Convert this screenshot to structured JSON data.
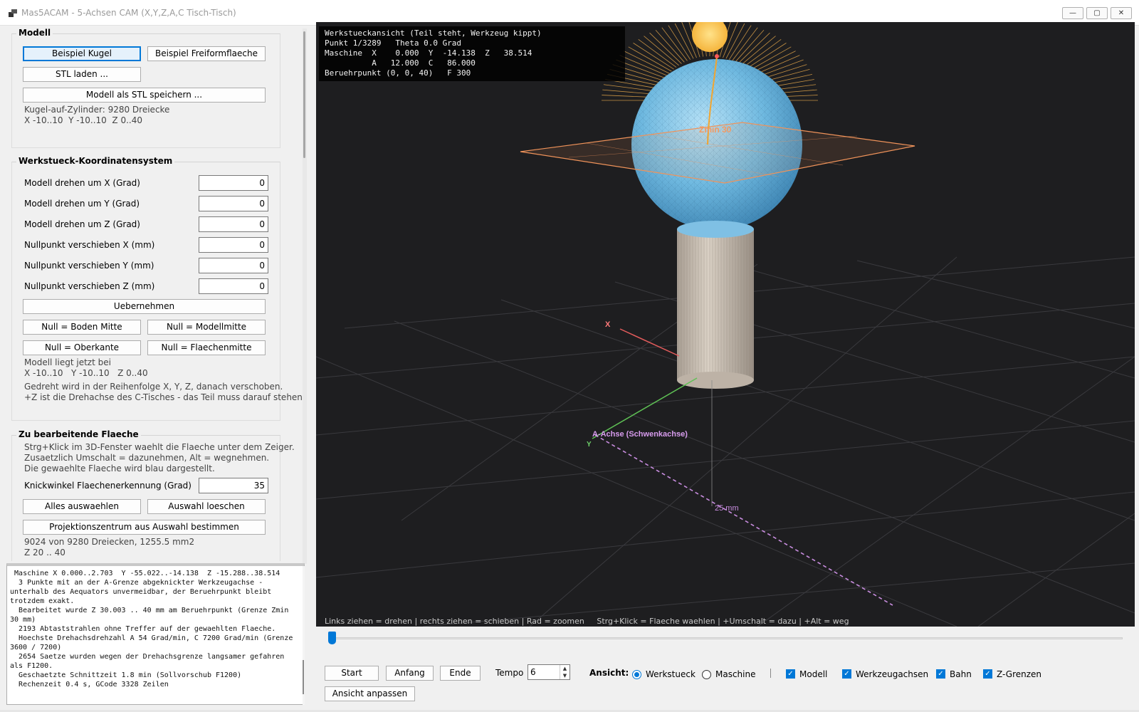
{
  "window": {
    "title": "Mas5ACAM - 5-Achsen CAM (X,Y,Z,A,C Tisch-Tisch)",
    "minimize": "—",
    "maximize": "▢",
    "close": "✕"
  },
  "modell": {
    "title": "Modell",
    "btn_kugel": "Beispiel Kugel",
    "btn_freiform": "Beispiel Freiformflaeche",
    "btn_stl_laden": "STL laden ...",
    "btn_stl_speichern": "Modell als STL speichern ...",
    "info_line1": "Kugel-auf-Zylinder: 9280 Dreiecke",
    "info_line2": "X -10..10  Y -10..10  Z 0..40"
  },
  "wks": {
    "title": "Werkstueck-Koordinatensystem",
    "fields": [
      {
        "label": "Modell drehen um X (Grad)",
        "value": "0"
      },
      {
        "label": "Modell drehen um Y (Grad)",
        "value": "0"
      },
      {
        "label": "Modell drehen um Z (Grad)",
        "value": "0"
      },
      {
        "label": "Nullpunkt verschieben X (mm)",
        "value": "0"
      },
      {
        "label": "Nullpunkt verschieben Y (mm)",
        "value": "0"
      },
      {
        "label": "Nullpunkt verschieben Z (mm)",
        "value": "0"
      }
    ],
    "btn_uebernehmen": "Uebernehmen",
    "btn_boden_mitte": "Null = Boden Mitte",
    "btn_modellmitte": "Null = Modellmitte",
    "btn_oberkante": "Null = Oberkante",
    "btn_flaechenmitte": "Null = Flaechenmitte",
    "info_line1": "Modell liegt jetzt bei",
    "info_line2": "X -10..10   Y -10..10   Z 0..40",
    "info_line3": "Gedreht wird in der Reihenfolge X, Y, Z, danach verschoben.",
    "info_line4": "+Z ist die Drehachse des C-Tisches - das Teil muss darauf stehen."
  },
  "flaeche": {
    "title": "Zu bearbeitende Flaeche",
    "info_line1": "Strg+Klick im 3D-Fenster waehlt die Flaeche unter dem Zeiger.",
    "info_line2": "Zusaetzlich Umschalt = dazunehmen, Alt = wegnehmen.",
    "info_line3": "Die gewaehlte Flaeche wird blau dargestellt.",
    "knick_label": "Knickwinkel Flaechenerkennung (Grad)",
    "knick_value": "35",
    "btn_alles": "Alles auswaehlen",
    "btn_loeschen": "Auswahl loeschen",
    "btn_projektion": "Projektionszentrum aus Auswahl bestimmen",
    "stat_line1": "9024 von 9280 Dreiecken, 1255.5 mm2",
    "stat_line2": "Z 20 .. 40"
  },
  "log": [
    " Maschine X 0.000..2.703  Y -55.022..-14.138  Z -15.288..38.514",
    "  3 Punkte mit an der A-Grenze abgeknickter Werkzeugachse - unterhalb des Aequators unvermeidbar, der Beruehrpunkt bleibt trotzdem exakt.",
    "  Bearbeitet wurde Z 30.003 .. 40 mm am Beruehrpunkt (Grenze Zmin 30 mm)",
    "  2193 Abtaststrahlen ohne Treffer auf der gewaehlten Flaeche.",
    "  Hoechste Drehachsdrehzahl A 54 Grad/min, C 7200 Grad/min (Grenze 3600 / 7200)",
    "  2654 Saetze wurden wegen der Drehachsgrenze langsamer gefahren als F1200.",
    "  Geschaetzte Schnittzeit 1.8 min (Sollvorschub F1200)",
    "  Rechenzeit 0.4 s, GCode 3328 Zeilen"
  ],
  "viewport": {
    "overlay": [
      "Werkstueckansicht (Teil steht, Werkzeug kippt)",
      "Punkt 1/3289   Theta 0.0 Grad",
      "Maschine  X    0.000  Y  -14.138  Z   38.514",
      "          A   12.000  C   86.000",
      "Beruehrpunkt (0, 0, 40)   F 300"
    ],
    "label_zmin": "Zmin 30",
    "label_x": "X",
    "label_y": "Y",
    "label_a_axis": "A-Achse (Schwenkachse)",
    "label_25mm": "25 mm",
    "hint": "Links ziehen = drehen | rechts ziehen = schieben | Rad = zoomen     Strg+Klick = Flaeche waehlen | +Umschalt = dazu | +Alt = weg"
  },
  "playback": {
    "position": 0.0003,
    "btn_start": "Start",
    "btn_anfang": "Anfang",
    "btn_ende": "Ende",
    "tempo_label": "Tempo",
    "tempo_value": "6",
    "ansicht_label": "Ansicht:",
    "radio_werkstueck": "Werkstueck",
    "radio_maschine": "Maschine",
    "werkstueck_selected": true,
    "chk_modell": "Modell",
    "chk_werkzeugachsen": "Werkzeugachsen",
    "chk_bahn": "Bahn",
    "chk_zgrenzen": "Z-Grenzen",
    "btn_ansicht_anpassen": "Ansicht anpassen"
  },
  "colors": {
    "accent": "#0078d7",
    "viewport_bg": "#1e1e20",
    "sphere": "#5fb0dc",
    "cylinder": "#c9bfb2",
    "plane": "#f0935a",
    "tool": "#f7c04d",
    "a_axis": "#c98de0"
  }
}
